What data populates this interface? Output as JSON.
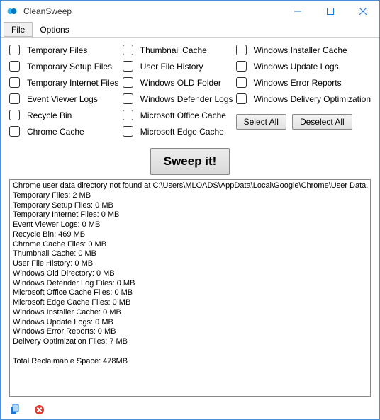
{
  "window": {
    "title": "CleanSweep"
  },
  "menu": {
    "file": "File",
    "options": "Options"
  },
  "checks": {
    "col1": [
      {
        "label": "Temporary Files"
      },
      {
        "label": "Temporary Setup Files"
      },
      {
        "label": "Temporary Internet Files"
      },
      {
        "label": "Event Viewer Logs"
      },
      {
        "label": "Recycle Bin"
      },
      {
        "label": "Chrome Cache"
      }
    ],
    "col2": [
      {
        "label": "Thumbnail Cache"
      },
      {
        "label": "User File History"
      },
      {
        "label": "Windows OLD Folder"
      },
      {
        "label": "Windows Defender Logs"
      },
      {
        "label": "Microsoft Office Cache"
      },
      {
        "label": "Microsoft Edge Cache"
      }
    ],
    "col3": [
      {
        "label": "Windows Installer Cache"
      },
      {
        "label": "Windows Update Logs"
      },
      {
        "label": "Windows Error Reports"
      },
      {
        "label": "Windows Delivery Optimization"
      }
    ]
  },
  "buttons": {
    "select_all": "Select All",
    "deselect_all": "Deselect All",
    "sweep": "Sweep it!"
  },
  "output_lines": [
    "Chrome user data directory not found at C:\\Users\\MLOADS\\AppData\\Local\\Google\\Chrome\\User Data.",
    "Temporary Files: 2 MB",
    "Temporary Setup Files: 0 MB",
    "Temporary Internet Files: 0 MB",
    "Event Viewer Logs: 0 MB",
    "Recycle Bin: 469 MB",
    "Chrome Cache Files: 0 MB",
    "Thumbnail Cache: 0 MB",
    "User File History: 0 MB",
    "Windows Old Directory: 0 MB",
    "Windows Defender Log Files: 0 MB",
    "Microsoft Office Cache Files: 0 MB",
    "Microsoft Edge Cache Files: 0 MB",
    "Windows Installer Cache: 0 MB",
    "Windows Update Logs: 0 MB",
    "Windows Error Reports: 0 MB",
    "Delivery Optimization Files: 7 MB",
    "",
    "Total Reclaimable Space: 478MB"
  ]
}
